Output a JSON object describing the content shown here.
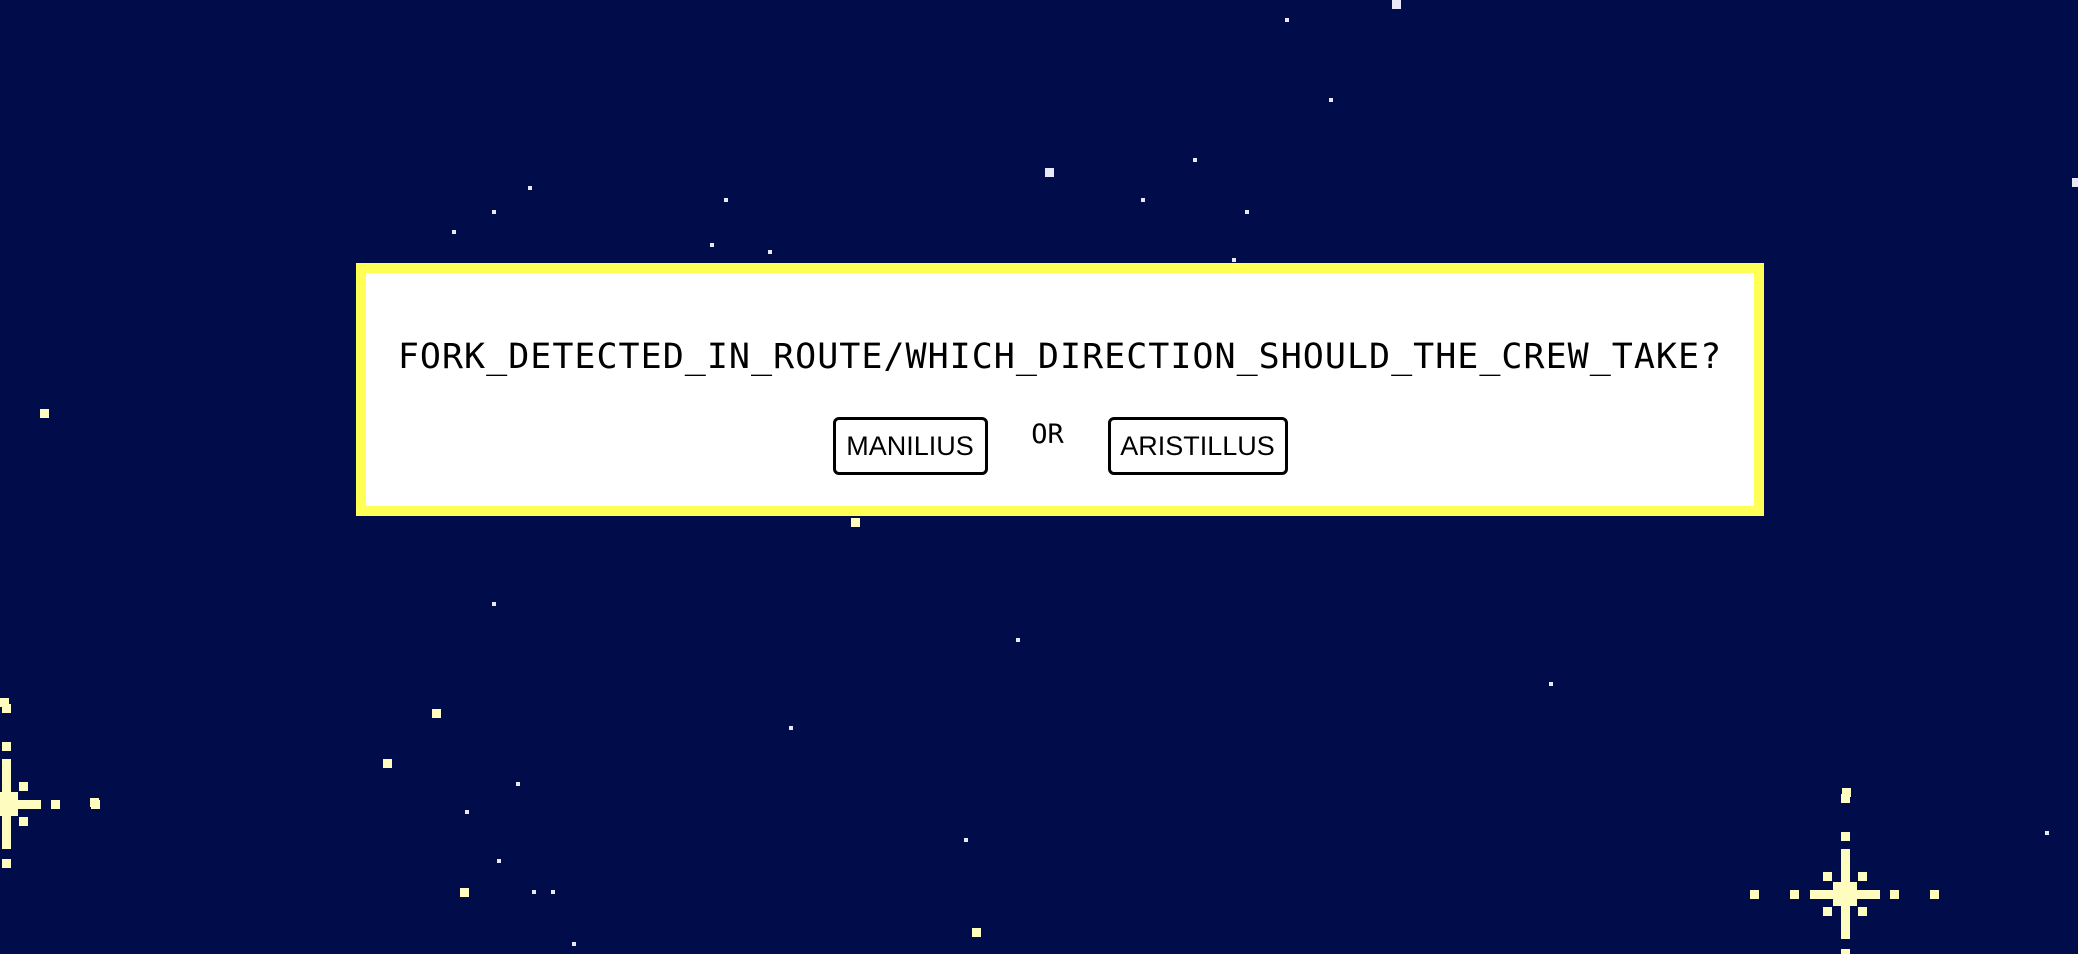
{
  "game": {
    "prompt": "FORK_DETECTED_IN_ROUTE/WHICH_DIRECTION_SHOULD_THE_CREW_TAKE?",
    "choice_a": "MANILIUS",
    "separator": "OR",
    "choice_b": "ARISTILLUS"
  },
  "colors": {
    "sky": "#010c4a",
    "dialog_border": "#ffff55",
    "dialog_background": "#ffffff",
    "star": "#e8e8f8",
    "sparkle": "#fffcc0"
  }
}
